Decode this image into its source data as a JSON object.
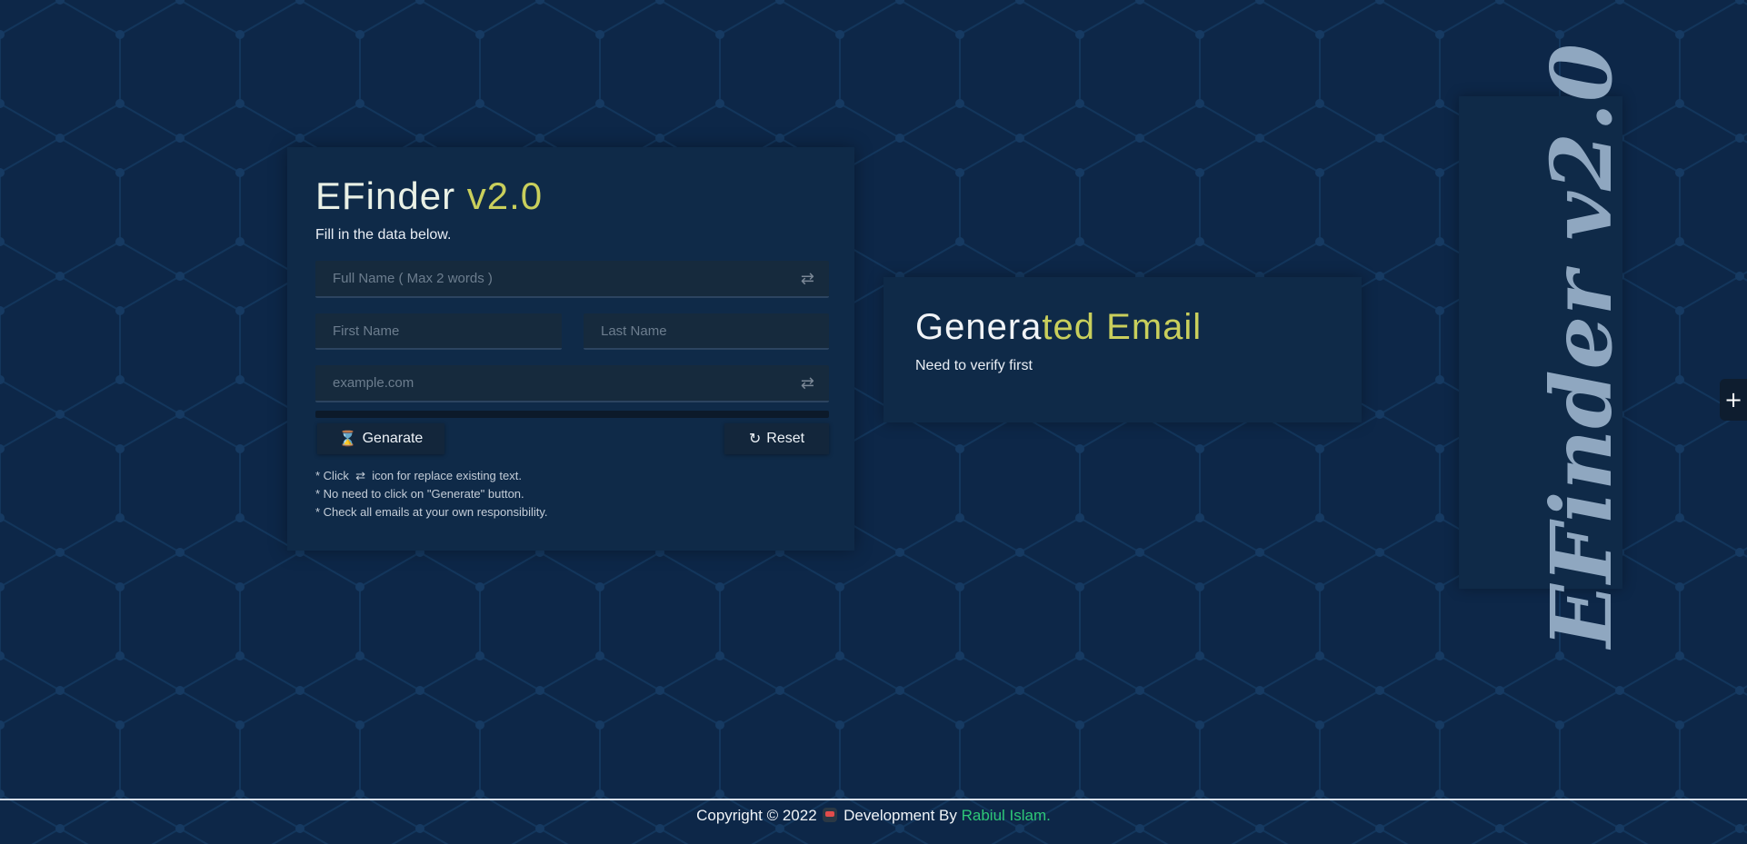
{
  "app": {
    "title_part1": "EFinder",
    "title_part2": " v2.0",
    "subtitle": "Fill in the data below."
  },
  "form": {
    "full_name_placeholder": "Full Name ( Max 2 words )",
    "first_name_placeholder": "First Name",
    "last_name_placeholder": "Last Name",
    "domain_placeholder": "example.com",
    "generate_label": "Genarate",
    "reset_label": "Reset"
  },
  "notes": {
    "line1_prefix": "* Click",
    "line1_suffix": "icon for replace existing text.",
    "line2": "* No need to click on \"Generate\" button.",
    "line3": "* Check all emails at your own responsibility."
  },
  "result": {
    "title_part1": "Genera",
    "title_part2": "ted Email",
    "status": "Need to verify first"
  },
  "side_banner": "EFinder v2.0",
  "plus_label": "+",
  "footer": {
    "copyright": "Copyright © 2022",
    "development_by": "Development By",
    "author": "Rabiul Islam."
  },
  "colors": {
    "background": "#0d2748",
    "accent": "#c9cf5c",
    "author": "#2ec878"
  },
  "icons": {
    "swap": "swap-icon",
    "hourglass": "hourglass-icon",
    "reload": "reload-icon",
    "plus": "plus-icon"
  }
}
